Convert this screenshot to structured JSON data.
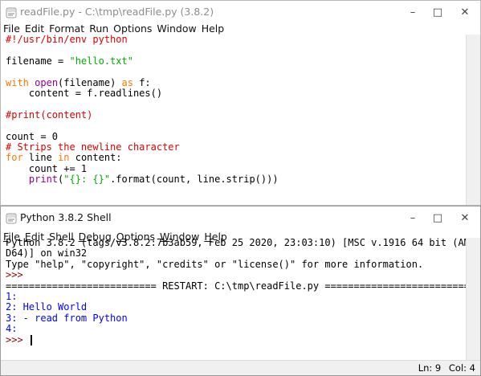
{
  "editor": {
    "title": "readFile.py - C:\\tmp\\readFile.py (3.8.2)",
    "menu": [
      "File",
      "Edit",
      "Format",
      "Run",
      "Options",
      "Window",
      "Help"
    ],
    "lines": [
      [
        {
          "t": "#!/usr/bin/env python",
          "c": "comment"
        }
      ],
      [],
      [
        {
          "t": "filename = "
        },
        {
          "t": "\"hello.txt\"",
          "c": "str"
        }
      ],
      [],
      [
        {
          "t": "with",
          "c": "kw"
        },
        {
          "t": " "
        },
        {
          "t": "open",
          "c": "builtin"
        },
        {
          "t": "(filename) "
        },
        {
          "t": "as",
          "c": "kw"
        },
        {
          "t": " f:"
        }
      ],
      [
        {
          "t": "    content = f.readlines()"
        }
      ],
      [],
      [
        {
          "t": "#print(content)",
          "c": "comment"
        }
      ],
      [],
      [
        {
          "t": "count = 0"
        }
      ],
      [
        {
          "t": "# Strips the newline character",
          "c": "comment"
        }
      ],
      [
        {
          "t": "for",
          "c": "kw"
        },
        {
          "t": " line "
        },
        {
          "t": "in",
          "c": "kw"
        },
        {
          "t": " content:"
        }
      ],
      [
        {
          "t": "    count += 1"
        }
      ],
      [
        {
          "t": "    "
        },
        {
          "t": "print",
          "c": "builtin"
        },
        {
          "t": "("
        },
        {
          "t": "\"{}: {}\"",
          "c": "str"
        },
        {
          "t": ".format(count, line.strip()))"
        }
      ]
    ]
  },
  "shell": {
    "title": "Python 3.8.2 Shell",
    "menu": [
      {
        "u": "F",
        "rest": "ile"
      },
      {
        "u": "E",
        "rest": "dit"
      },
      {
        "pre": "She",
        "u": "l",
        "rest": "l"
      },
      {
        "u": "D",
        "rest": "ebug"
      },
      {
        "u": "O",
        "rest": "ptions"
      },
      {
        "u": "W",
        "rest": "indow"
      },
      {
        "u": "H",
        "rest": "elp"
      }
    ],
    "lines": [
      [
        {
          "t": "Python 3.8.2 (tags/v3.8.2:7b3ab59, Feb 25 2020, 23:03:10) [MSC v.1916 64 bit (AM"
        }
      ],
      [
        {
          "t": "D64)] on win32"
        }
      ],
      [
        {
          "t": "Type \"help\", \"copyright\", \"credits\" or \"license()\" for more information."
        }
      ],
      [
        {
          "t": ">>> ",
          "c": "prompt"
        }
      ],
      [
        {
          "t": "========================== RESTART: C:\\tmp\\readFile.py =========================="
        }
      ],
      [
        {
          "t": "1:",
          "c": "out"
        }
      ],
      [
        {
          "t": "2: Hello World",
          "c": "out"
        }
      ],
      [
        {
          "t": "3: - read from Python",
          "c": "out"
        }
      ],
      [
        {
          "t": "4:",
          "c": "out"
        }
      ],
      [
        {
          "t": ">>> ",
          "c": "prompt"
        }
      ]
    ],
    "status": {
      "ln": "Ln: 9",
      "col": "Col: 4"
    }
  }
}
